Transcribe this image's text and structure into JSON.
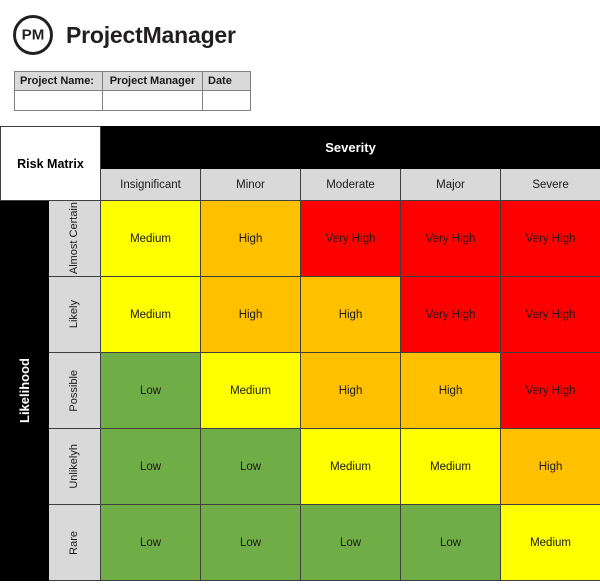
{
  "brand": {
    "logo_icon": "pm-circle-logo",
    "logo_text": "PM",
    "name": "ProjectManager"
  },
  "project_info": {
    "headers": [
      "Project Name:",
      "Project Manager",
      "Date"
    ],
    "values": [
      "",
      "",
      ""
    ]
  },
  "matrix": {
    "corner_label": "Risk Matrix",
    "severity_label": "Severity",
    "likelihood_label": "Likelihood",
    "severity_levels": [
      "Insignificant",
      "Minor",
      "Moderate",
      "Major",
      "Severe"
    ],
    "likelihood_levels": [
      "Almost Certain",
      "Likely",
      "Possible",
      "Unlikelyh",
      "Rare"
    ]
  },
  "colors": {
    "low": "#70AD47",
    "medium": "#FFFF00",
    "high": "#FFC000",
    "very_high": "#FF0000",
    "header_grey": "#D9D9D9",
    "header_black": "#000000",
    "page_background": "#FFFFFF",
    "brand_text": "#231F20"
  },
  "chart_data": {
    "type": "heatmap",
    "title": "Risk Matrix",
    "xlabel": "Severity",
    "ylabel": "Likelihood",
    "x_categories": [
      "Insignificant",
      "Minor",
      "Moderate",
      "Major",
      "Severe"
    ],
    "y_categories": [
      "Almost Certain",
      "Likely",
      "Possible",
      "Unlikelyh",
      "Rare"
    ],
    "legend": [
      "Low",
      "Medium",
      "High",
      "Very High"
    ],
    "cells": [
      [
        "Medium",
        "High",
        "Very High",
        "Very High",
        "Very High"
      ],
      [
        "Medium",
        "High",
        "High",
        "Very High",
        "Very High"
      ],
      [
        "Low",
        "Medium",
        "High",
        "High",
        "Very High"
      ],
      [
        "Low",
        "Low",
        "Medium",
        "Medium",
        "High"
      ],
      [
        "Low",
        "Low",
        "Low",
        "Low",
        "Medium"
      ]
    ],
    "cell_classes": [
      [
        "lvl-medium",
        "lvl-high",
        "lvl-veryhigh",
        "lvl-veryhigh",
        "lvl-veryhigh"
      ],
      [
        "lvl-medium",
        "lvl-high",
        "lvl-high",
        "lvl-veryhigh",
        "lvl-veryhigh"
      ],
      [
        "lvl-low",
        "lvl-medium",
        "lvl-high",
        "lvl-high",
        "lvl-veryhigh"
      ],
      [
        "lvl-low",
        "lvl-low",
        "lvl-medium",
        "lvl-medium",
        "lvl-high"
      ],
      [
        "lvl-low",
        "lvl-low",
        "lvl-low",
        "lvl-low",
        "lvl-medium"
      ]
    ]
  }
}
